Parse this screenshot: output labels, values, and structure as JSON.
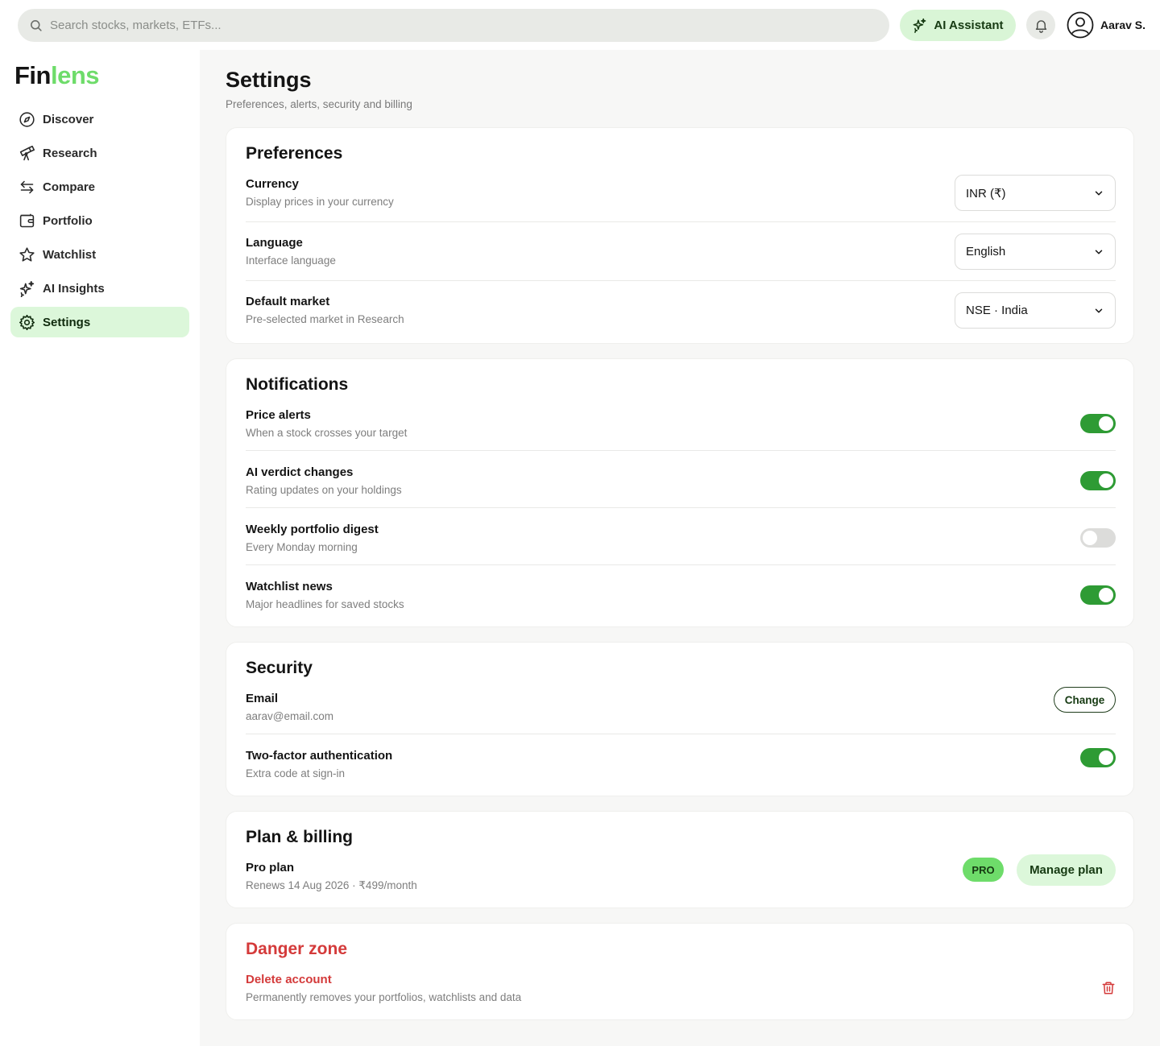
{
  "app": {
    "logo_part1": "Fin",
    "logo_part2": "lens"
  },
  "topbar": {
    "search_placeholder": "Search stocks, markets, ETFs...",
    "ai_label": "AI Assistant",
    "user_name": "Aarav S."
  },
  "sidebar": {
    "items": [
      {
        "label": "Discover",
        "icon": "compass-icon"
      },
      {
        "label": "Research",
        "icon": "telescope-icon"
      },
      {
        "label": "Compare",
        "icon": "arrows-icon"
      },
      {
        "label": "Portfolio",
        "icon": "wallet-icon"
      },
      {
        "label": "Watchlist",
        "icon": "star-icon"
      },
      {
        "label": "AI Insights",
        "icon": "sparkles-icon"
      },
      {
        "label": "Settings",
        "icon": "gear-icon",
        "active": true
      }
    ]
  },
  "page": {
    "title": "Settings",
    "subtitle": "Preferences, alerts, security and billing"
  },
  "preferences": {
    "title": "Preferences",
    "rows": [
      {
        "label": "Currency",
        "desc": "Display prices in your currency",
        "value": "INR (₹)"
      },
      {
        "label": "Language",
        "desc": "Interface language",
        "value": "English"
      },
      {
        "label": "Default market",
        "desc": "Pre-selected market in Research",
        "value": "NSE · India"
      }
    ]
  },
  "notifications": {
    "title": "Notifications",
    "rows": [
      {
        "label": "Price alerts",
        "desc": "When a stock crosses your target",
        "enabled": true
      },
      {
        "label": "AI verdict changes",
        "desc": "Rating updates on your holdings",
        "enabled": true
      },
      {
        "label": "Weekly portfolio digest",
        "desc": "Every Monday morning",
        "enabled": false
      },
      {
        "label": "Watchlist news",
        "desc": "Major headlines for saved stocks",
        "enabled": true
      }
    ]
  },
  "security": {
    "title": "Security",
    "email_label": "Email",
    "email_value": "aarav@email.com",
    "change_label": "Change",
    "twofa_label": "Two-factor authentication",
    "twofa_desc": "Extra code at sign-in",
    "twofa_enabled": true
  },
  "billing": {
    "title": "Plan & billing",
    "plan_label": "Pro plan",
    "plan_desc": "Renews 14 Aug 2026 · ₹499/month",
    "badge": "PRO",
    "manage_label": "Manage plan"
  },
  "danger": {
    "title": "Danger zone",
    "delete_label": "Delete account",
    "delete_desc": "Permanently removes your portfolios, watchlists and data"
  },
  "colors": {
    "accent": "#6edc6a",
    "accent_soft": "#dcf7da",
    "toggle_on": "#2e9b34",
    "danger": "#d43a3a"
  }
}
